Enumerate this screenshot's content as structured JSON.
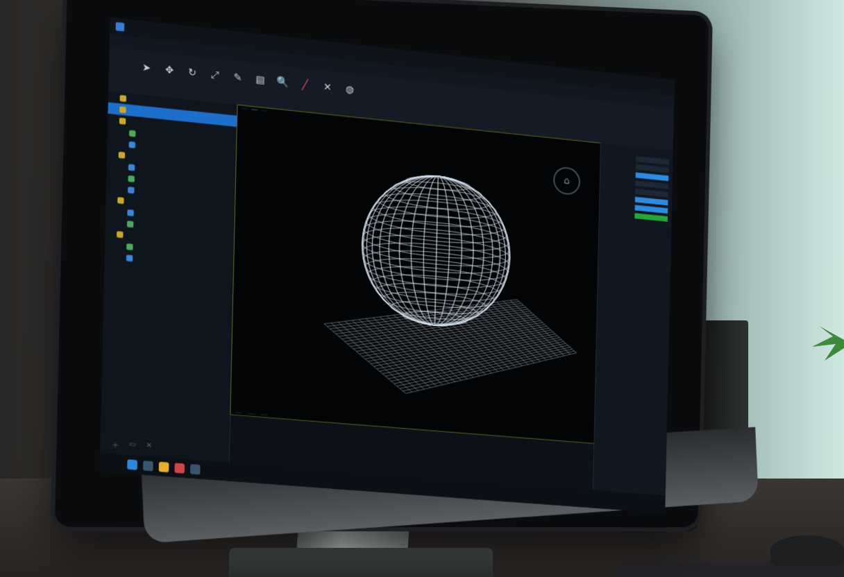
{
  "app": {
    "title": "",
    "document_title": ""
  },
  "menu": [
    "",
    "",
    "",
    "",
    "",
    ""
  ],
  "ribbon": {
    "tabs": [
      "",
      "",
      "",
      "",
      "",
      ""
    ],
    "tools": [
      {
        "icon": "cursor-icon",
        "label": ""
      },
      {
        "icon": "move-icon",
        "label": ""
      },
      {
        "icon": "rotate-icon",
        "label": ""
      },
      {
        "icon": "scale-icon",
        "label": ""
      },
      {
        "icon": "brush-icon",
        "label": ""
      },
      {
        "icon": "layers-icon",
        "label": ""
      },
      {
        "icon": "search-icon",
        "label": ""
      },
      {
        "icon": "pen-icon",
        "label": ""
      },
      {
        "icon": "cut-icon",
        "label": ""
      },
      {
        "icon": "globe-icon",
        "label": ""
      }
    ]
  },
  "sidebar": {
    "items": [
      {
        "label": "",
        "icon": "folder"
      },
      {
        "label": "",
        "icon": "folder",
        "active": true
      },
      {
        "label": "",
        "icon": "folder"
      },
      {
        "label": "",
        "icon": "mesh"
      },
      {
        "label": "",
        "icon": "mesh"
      },
      {
        "label": "",
        "icon": "folder"
      },
      {
        "label": "",
        "icon": "mesh"
      },
      {
        "label": "",
        "icon": "mesh"
      },
      {
        "label": "",
        "icon": "mesh"
      },
      {
        "label": "",
        "icon": "folder"
      },
      {
        "label": "",
        "icon": "mesh"
      },
      {
        "label": "",
        "icon": "mesh"
      },
      {
        "label": "",
        "icon": "folder"
      },
      {
        "label": "",
        "icon": "mesh"
      },
      {
        "label": "",
        "icon": "mesh"
      }
    ]
  },
  "viewport": {
    "tabs": [
      "",
      "",
      ""
    ],
    "status": [
      "",
      "",
      ""
    ],
    "colors": {
      "border": "#5c6b25",
      "wire": "#d6e4f4"
    }
  },
  "properties": {
    "title": "",
    "rows": [
      {
        "label": "",
        "kind": "plain"
      },
      {
        "label": "",
        "kind": "plain"
      },
      {
        "label": "",
        "kind": "blue"
      },
      {
        "label": "",
        "kind": "plain"
      },
      {
        "label": "",
        "kind": "plain"
      },
      {
        "label": "",
        "kind": "blue"
      },
      {
        "label": "",
        "kind": "blue"
      },
      {
        "label": "",
        "kind": "green"
      }
    ]
  },
  "taskbar": {
    "label": ""
  }
}
